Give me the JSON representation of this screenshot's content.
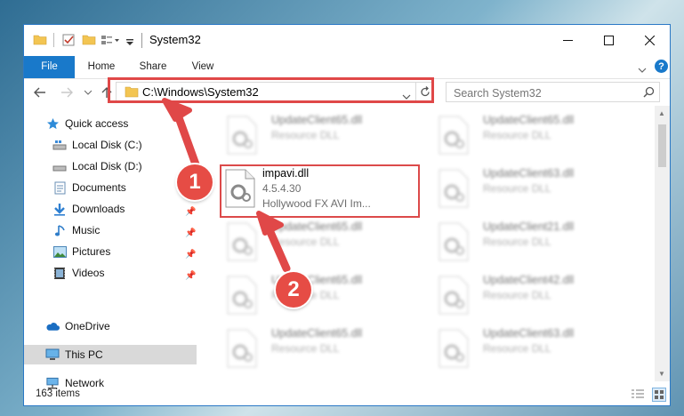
{
  "window": {
    "title": "System32"
  },
  "ribbon": {
    "tabs": [
      "File",
      "Home",
      "Share",
      "View"
    ]
  },
  "address": {
    "path": "C:\\Windows\\System32"
  },
  "search": {
    "placeholder": "Search System32"
  },
  "nav": {
    "items": [
      {
        "label": "Quick access",
        "icon": "star-icon",
        "pinned": false
      },
      {
        "label": "Local Disk (C:)",
        "icon": "drive-icon",
        "pinned": false
      },
      {
        "label": "Local Disk (D:)",
        "icon": "drive-icon",
        "pinned": false
      },
      {
        "label": "Documents",
        "icon": "documents-icon",
        "pinned": true
      },
      {
        "label": "Downloads",
        "icon": "download-icon",
        "pinned": true
      },
      {
        "label": "Music",
        "icon": "music-icon",
        "pinned": true
      },
      {
        "label": "Pictures",
        "icon": "pictures-icon",
        "pinned": true
      },
      {
        "label": "Videos",
        "icon": "videos-icon",
        "pinned": true
      },
      {
        "label": "OneDrive",
        "icon": "cloud-icon",
        "pinned": false
      },
      {
        "label": "This PC",
        "icon": "computer-icon",
        "pinned": false,
        "selected": true
      },
      {
        "label": "Network",
        "icon": "network-icon",
        "pinned": false
      }
    ]
  },
  "files": [
    {
      "name": "UpdateClient65.dll",
      "type": "Resource DLL",
      "blurred": true
    },
    {
      "name": "UpdateClient65.dll",
      "type": "Resource DLL",
      "blurred": true
    },
    {
      "name": "impavi.dll",
      "version": "4.5.4.30",
      "description": "Hollywood FX AVI Im...",
      "highlighted": true
    },
    {
      "name": "UpdateClient63.dll",
      "type": "Resource DLL",
      "blurred": true
    },
    {
      "name": "UpdateClient65.dll",
      "type": "Resource DLL",
      "blurred": true
    },
    {
      "name": "UpdateClient21.dll",
      "type": "Resource DLL",
      "blurred": true
    },
    {
      "name": "UpdateClient65.dll",
      "type": "Resource DLL",
      "blurred": true
    },
    {
      "name": "UpdateClient42.dll",
      "type": "Resource DLL",
      "blurred": true
    },
    {
      "name": "UpdateClient65.dll",
      "type": "Resource DLL",
      "blurred": true
    },
    {
      "name": "UpdateClient63.dll",
      "type": "Resource DLL",
      "blurred": true
    }
  ],
  "status": {
    "item_count": "163 items"
  },
  "annotations": {
    "step1": "1",
    "step2": "2"
  },
  "colors": {
    "accent": "#1979ca",
    "annotation": "#e04848"
  }
}
